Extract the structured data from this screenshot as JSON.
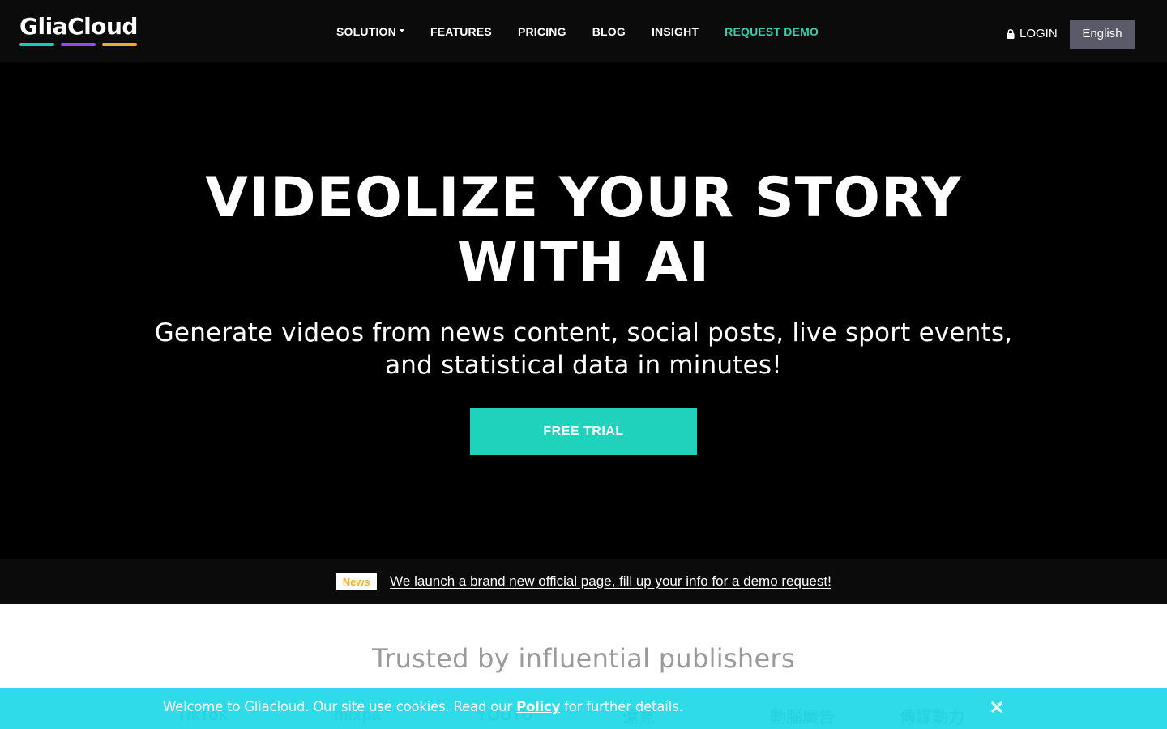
{
  "navbar": {
    "logo_text": "GliaCloud",
    "brand_colors": [
      "#1ec9b4",
      "#8d4ee6",
      "#f0a73a"
    ],
    "links": [
      {
        "label": "SOLUTION",
        "has_dropdown": true
      },
      {
        "label": "FEATURES"
      },
      {
        "label": "PRICING"
      },
      {
        "label": "BLOG"
      },
      {
        "label": "INSIGHT"
      },
      {
        "label": "REQUEST DEMO",
        "accent": "#2ed3b0"
      }
    ],
    "login_label": "LOGIN",
    "login_icon": "lock-icon",
    "language_label": "English"
  },
  "hero": {
    "title_line1": "VIDEOLIZE YOUR STORY",
    "title_line2": "WITH AI",
    "subtitle_line1": "Generate videos from news content, social posts, live sport events,",
    "subtitle_line2": "and statistical data in minutes!",
    "cta_label": "FREE TRIAL",
    "cta_color": "#1ed2bb"
  },
  "news": {
    "badge": "News",
    "text": "We launch a brand new official page, fill up your info for a demo request!"
  },
  "trusted": {
    "title": "Trusted by influential publishers",
    "logos": [
      "TikTok",
      "mixpa",
      "YOUTU",
      "遠見",
      "動腦廣告",
      "傳媒動力"
    ]
  },
  "cookie": {
    "text_before": "Welcome to Gliacloud. Our site use cookies. Read our ",
    "policy_label": "Policy",
    "text_after": " for further details.",
    "close_icon": "close-icon"
  }
}
